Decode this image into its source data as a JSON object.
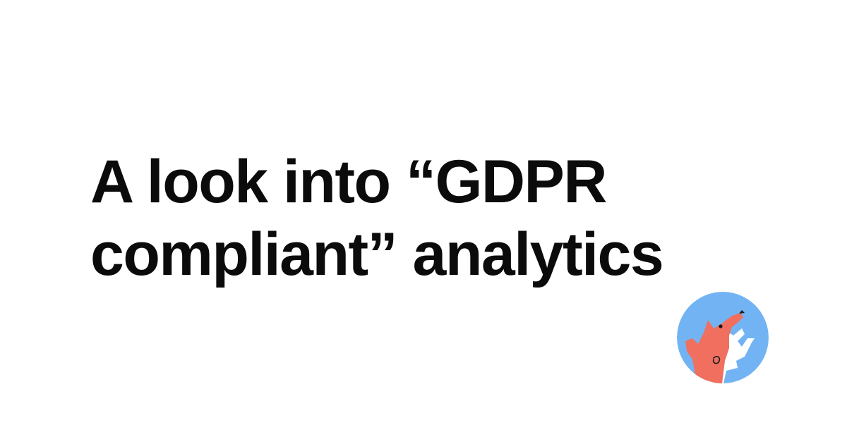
{
  "headline": {
    "line1": "A look into “GDPR",
    "line2": "compliant” analytics"
  },
  "avatar": {
    "icon": "fox-mascot-icon",
    "background_color": "#72b4f3",
    "fox_color": "#f06f5e",
    "accent_color": "#ffffff"
  },
  "colors": {
    "background": "#ffffff",
    "text": "#0b0b0b"
  }
}
